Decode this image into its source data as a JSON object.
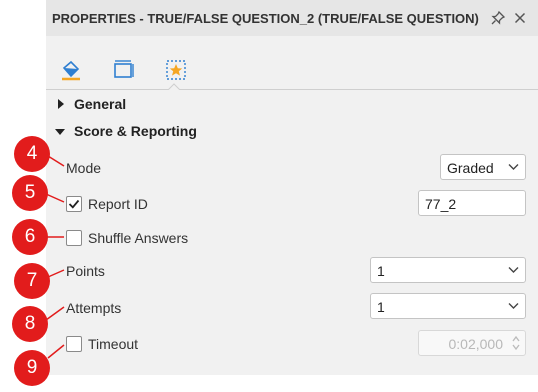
{
  "panel": {
    "title": "PROPERTIES - TRUE/FALSE QUESTION_2 (TRUE/FALSE QUESTION)",
    "pin_icon": "pin-icon",
    "close_icon": "close-icon"
  },
  "tabs": [
    {
      "icon": "paint-bucket-icon",
      "active": false
    },
    {
      "icon": "resize-icon",
      "active": false
    },
    {
      "icon": "star-frame-icon",
      "active": true
    }
  ],
  "sections": {
    "general": {
      "label": "General",
      "expanded": false
    },
    "score": {
      "label": "Score & Reporting",
      "expanded": true
    }
  },
  "fields": {
    "mode": {
      "label": "Mode",
      "value": "Graded"
    },
    "report_id": {
      "label": "Report ID",
      "checked": true,
      "value": "77_2"
    },
    "shuffle": {
      "label": "Shuffle Answers",
      "checked": false
    },
    "points": {
      "label": "Points",
      "value": "1"
    },
    "attempts": {
      "label": "Attempts",
      "value": "1"
    },
    "timeout": {
      "label": "Timeout",
      "checked": false,
      "value": "0:02,000"
    }
  },
  "callouts": [
    "4",
    "5",
    "6",
    "7",
    "8",
    "9"
  ],
  "colors": {
    "callout": "#e21c1c",
    "accent": "#f5a623"
  }
}
